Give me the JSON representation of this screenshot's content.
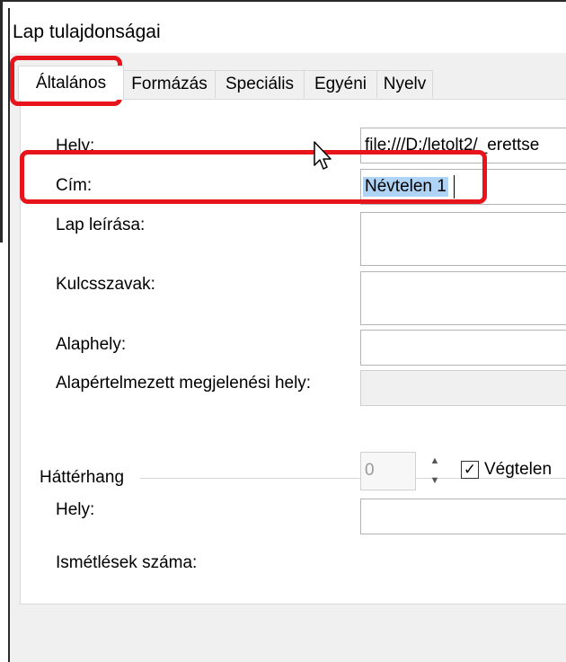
{
  "window": {
    "title": "Lap tulajdonságai"
  },
  "tabs": [
    {
      "label": "Általános"
    },
    {
      "label": "Formázás"
    },
    {
      "label": "Speciális"
    },
    {
      "label": "Egyéni"
    },
    {
      "label": "Nyelv"
    }
  ],
  "general": {
    "hely_label": "Hely:",
    "hely_value": "file:///D:/letolt2/_erettse",
    "cim_label": "Cím:",
    "cim_value": "Névtelen 1",
    "leiras_label": "Lap leírása:",
    "kulcsszavak_label": "Kulcsszavak:",
    "alaphely_label": "Alaphely:",
    "megjelenesi_label": "Alapértelmezett megjelenési hely:"
  },
  "background_sound": {
    "group_label": "Háttérhang",
    "hely_label": "Hely:",
    "ismetlesek_label": "Ismétlések száma:",
    "ismetlesek_value": "0",
    "vegtelen_label": "Végtelen",
    "vegtelen_checked": true
  },
  "highlight_color": "#e8141b"
}
